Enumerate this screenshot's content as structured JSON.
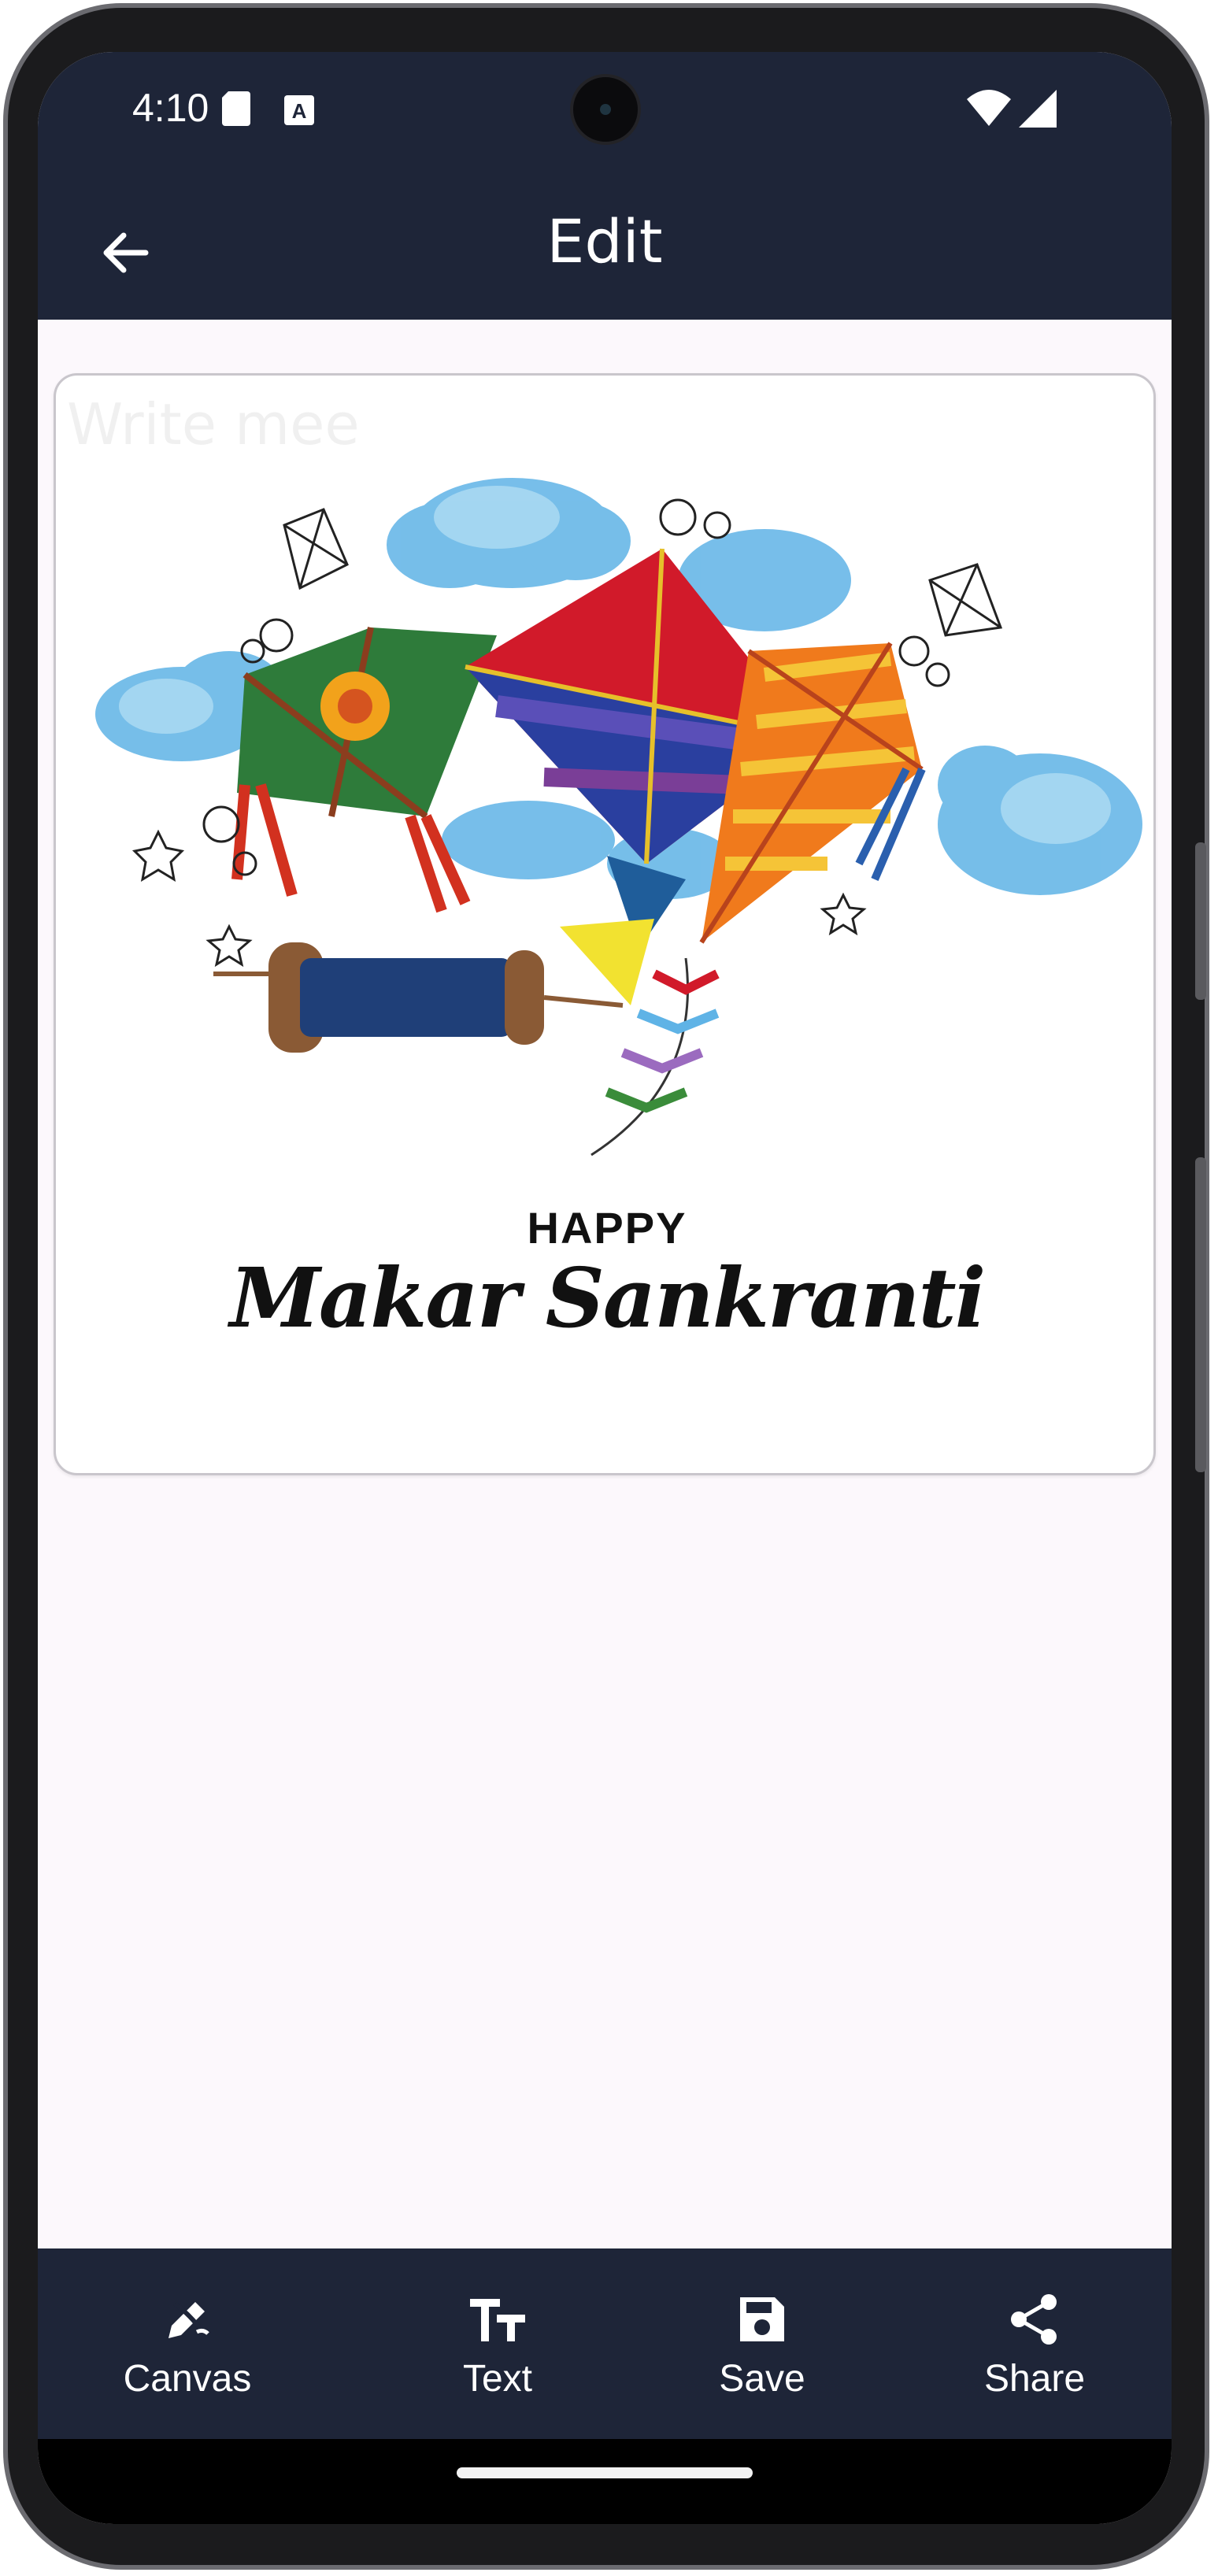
{
  "status_bar": {
    "time": "4:10"
  },
  "app_bar": {
    "title": "Edit",
    "back_icon": "arrow-back-icon"
  },
  "canvas": {
    "watermark": "Write mee",
    "greeting_line1": "HAPPY",
    "greeting_line2": "Makar Sankranti",
    "illustration": "kites-and-clouds-illustration"
  },
  "bottom_nav": {
    "items": [
      {
        "label": "Canvas",
        "icon": "canvas-edit-icon"
      },
      {
        "label": "Text",
        "icon": "text-size-icon"
      },
      {
        "label": "Save",
        "icon": "save-icon"
      },
      {
        "label": "Share",
        "icon": "share-icon"
      }
    ]
  },
  "colors": {
    "app_bar": "#1e2538",
    "background": "#fcf8fc",
    "on_primary": "#ffffff"
  }
}
